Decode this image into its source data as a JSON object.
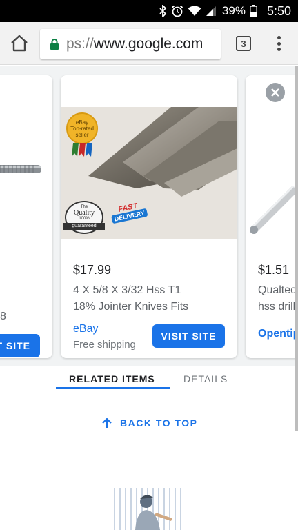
{
  "status_bar": {
    "battery": "39%",
    "time": "5:50"
  },
  "browser": {
    "url_scheme": "ps://",
    "url_host": "www.google.com",
    "tab_count": "3"
  },
  "products": {
    "left": {
      "visit_label": "T SITE",
      "desc_fragment": "8"
    },
    "main": {
      "price": "$17.99",
      "desc_line1": "4 X 5/8 X 3/32 Hss T1",
      "desc_line2": "18% Jointer Knives Fits",
      "seller": "eBay",
      "shipping": "Free shipping",
      "visit_label": "VISIT SITE",
      "badge_ebay": "eBay Top-rated seller",
      "badge_quality_top": "The",
      "badge_quality_main": "Quality",
      "badge_quality_pct": "100%",
      "badge_quality_bottom": "guaranteed",
      "badge_delivery_1": "FAST",
      "badge_delivery_2": "DELIVERY"
    },
    "right": {
      "price": "$1.51",
      "desc_line1": "Qualtec",
      "desc_line2": "hss drill",
      "seller": "Opentip"
    }
  },
  "tabs": {
    "related": "RELATED ITEMS",
    "details": "DETAILS"
  },
  "back_to_top": "BACK TO TOP",
  "colors": {
    "accent": "#1a73e8",
    "carousel_bg": "#f1f3f4"
  }
}
